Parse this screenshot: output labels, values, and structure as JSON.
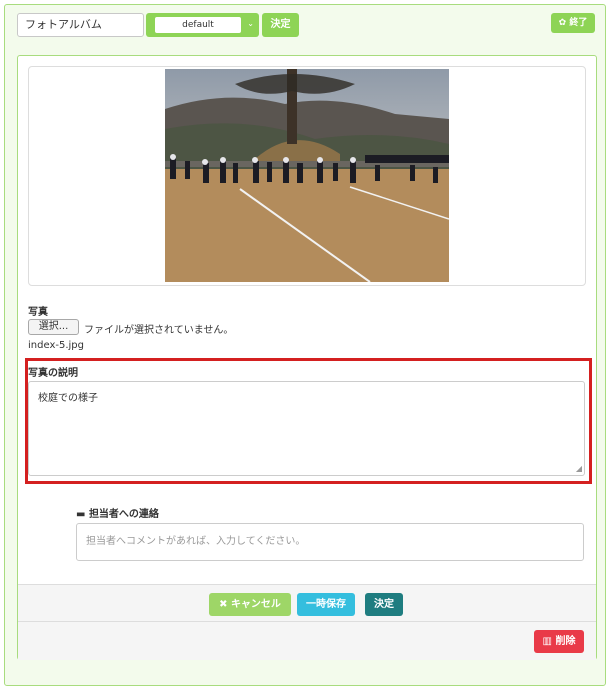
{
  "topbar": {
    "album_value": "フォトアルバム",
    "select_value": "default",
    "select_caret": "⌄",
    "decide_label": "決定",
    "end_icon": "gear-icon",
    "end_label": "終了"
  },
  "photo_section": {
    "label": "写真",
    "file_button_label": "選択...",
    "file_status": "ファイルが選択されていません。",
    "file_name": "index-5.jpg"
  },
  "description": {
    "label": "写真の説明",
    "value": "校庭での様子"
  },
  "contact": {
    "icon": "comment-icon",
    "label": "担当者への連絡",
    "placeholder": "担当者へコメントがあれば、入力してください。"
  },
  "footer": {
    "cancel_icon": "close-icon",
    "cancel_label": "キャンセル",
    "save_tmp_label": "一時保存",
    "decide_label": "決定",
    "delete_icon": "trash-icon",
    "delete_label": "削除"
  },
  "colors": {
    "accent_green": "#8ed456",
    "highlight_red": "#d42020",
    "info_blue": "#34bede",
    "teal": "#1f7d80",
    "danger": "#e93a48"
  }
}
